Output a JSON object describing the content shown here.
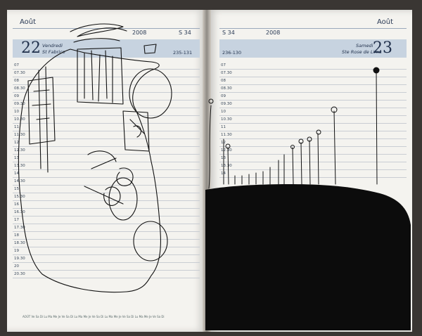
{
  "left_page": {
    "month": "Août",
    "year": "2008",
    "week": "S 34",
    "day_number": "22",
    "day_name": "Vendredi",
    "saint": "St Fabrice",
    "day_range": "235-131",
    "times": [
      "07",
      "07.30",
      "08",
      "08.30",
      "09",
      "09.30",
      "10",
      "10.30",
      "11",
      "11.30",
      "12",
      "12.30",
      "13",
      "13.30",
      "14",
      "14.30",
      "15",
      "15.30",
      "16",
      "16.30",
      "17",
      "17.30",
      "18",
      "18.30",
      "19",
      "19.30",
      "20",
      "20.30"
    ],
    "mini_calendar": "AOÛT  Ve Sa Di Lu Ma Me Je Ve Sa Di Lu Ma Me Je Ve Sa Di Lu Ma Me Je Ve Sa Di Lu Ma Me Je Ve Sa Di"
  },
  "right_page": {
    "month": "Août",
    "year": "2008",
    "week": "S 34",
    "day_number": "23",
    "day_name": "Samedi",
    "saint": "Ste Rose de Lima",
    "day_range": "236-130",
    "times": [
      "07",
      "07.30",
      "08",
      "08.30",
      "09",
      "09.30",
      "10",
      "10.30",
      "11",
      "11.30",
      "12",
      "12.30",
      "13",
      "13.30",
      "14"
    ]
  },
  "colors": {
    "ink": "#111111",
    "band": "#c7d3e0",
    "paper": "#f4f3ef",
    "print": "#1f2f4a"
  }
}
